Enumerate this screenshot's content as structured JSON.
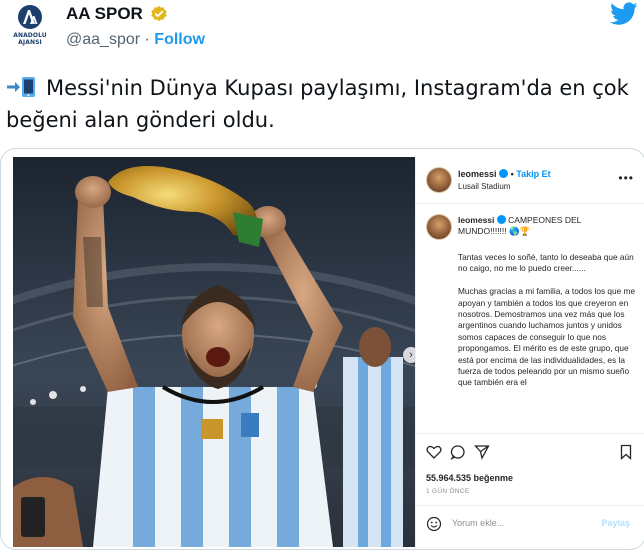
{
  "account": {
    "name": "AA SPOR",
    "handle": "@aa_spor",
    "separator": "·",
    "follow_label": "Follow",
    "logo_caption": "ANADOLU AJANSI"
  },
  "tweet": {
    "line1": "Messi'nin Dünya Kupası paylaşımı, Instagram'da en çok",
    "line2": "beğeni alan gönderi oldu."
  },
  "instagram": {
    "username": "leomessi",
    "follow_label": "Takip Et",
    "location": "Lusail Stadium",
    "caption_title": "CAMPEONES DEL MUNDO!!!!!!! 🌎🏆",
    "caption_body": "Tantas veces lo soñé, tanto lo deseaba que aún no caigo, no me lo puedo creer......\n\nMuchas gracias a mi familia, a todos los que me apoyan y también a todos los que creyeron en nosotros. Demostramos una vez más que los argentinos cuando luchamos juntos y unidos somos capaces de conseguir lo que nos propongamos. El mérito es de este grupo, que está por encima de las individualidades, es la fuerza de todos peleando por un mismo sueño que también era el",
    "likes": "55.964.535 beğenme",
    "time": "1 GÜN ÖNCE",
    "comment_placeholder": "Yorum ekle...",
    "share_label": "Paylaş"
  },
  "colors": {
    "twitter_blue": "#1d9bf0",
    "instagram_blue": "#0095f6",
    "verified_gold": "#e2b719"
  },
  "icons": [
    "anadolu-logo-icon",
    "verified-badge-icon",
    "twitter-bird-icon",
    "mobile-phone-arrow-icon",
    "heart-icon",
    "comment-icon",
    "share-icon",
    "bookmark-icon",
    "smile-icon",
    "more-icon",
    "next-arrow-icon"
  ]
}
